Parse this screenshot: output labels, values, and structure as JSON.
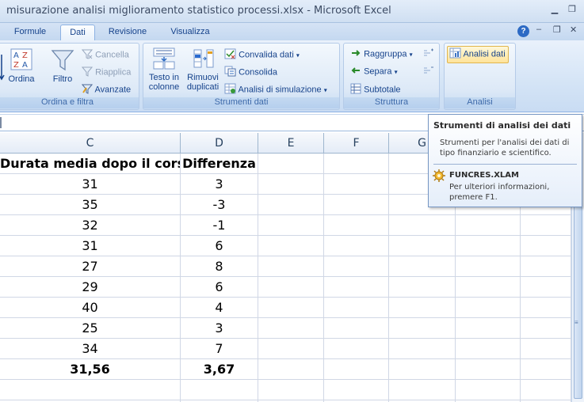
{
  "window": {
    "title": "misurazione analisi miglioramento statistico processi.xlsx - Microsoft Excel",
    "minimize_icon": "minimize-icon",
    "restore_icon": "restore-icon"
  },
  "tabs": [
    {
      "label": "Formule"
    },
    {
      "label": "Dati",
      "active": true
    },
    {
      "label": "Revisione"
    },
    {
      "label": "Visualizza"
    }
  ],
  "ribbon": {
    "sort_filter": {
      "group_label": "Ordina e filtra",
      "ordina": "Ordina",
      "filtro": "Filtro",
      "cancella": "Cancella",
      "riapplica": "Riapplica",
      "avanzate": "Avanzate"
    },
    "data_tools": {
      "group_label": "Strumenti dati",
      "testo_line1": "Testo in",
      "testo_line2": "colonne",
      "rimuovi_line1": "Rimuovi",
      "rimuovi_line2": "duplicati",
      "convalida": "Convalida dati",
      "consolida": "Consolida",
      "analisi_simulazione": "Analisi di simulazione"
    },
    "outline": {
      "group_label": "Struttura",
      "raggruppa": "Raggruppa",
      "separa": "Separa",
      "subtotale": "Subtotale"
    },
    "analysis": {
      "group_label": "Analisi",
      "analisi_dati": "Analisi dati"
    }
  },
  "sheet": {
    "columns": [
      "C",
      "D",
      "E",
      "F",
      "G"
    ],
    "headers": {
      "c": "Durata media dopo il corso",
      "d": "Differenza"
    },
    "rows": [
      {
        "c": "31",
        "d": "3"
      },
      {
        "c": "35",
        "d": "-3"
      },
      {
        "c": "32",
        "d": "-1"
      },
      {
        "c": "31",
        "d": "6"
      },
      {
        "c": "27",
        "d": "8"
      },
      {
        "c": "29",
        "d": "6"
      },
      {
        "c": "40",
        "d": "4"
      },
      {
        "c": "25",
        "d": "3"
      },
      {
        "c": "34",
        "d": "7"
      }
    ],
    "totals": {
      "c": "31,56",
      "d": "3,67"
    }
  },
  "tooltip": {
    "title": "Strumenti di analisi dei dati",
    "description": "Strumenti per l'analisi dei dati di tipo finanziario e scientifico.",
    "addin": "FUNCRES.XLAM",
    "help": "Per ulteriori informazioni, premere F1."
  }
}
